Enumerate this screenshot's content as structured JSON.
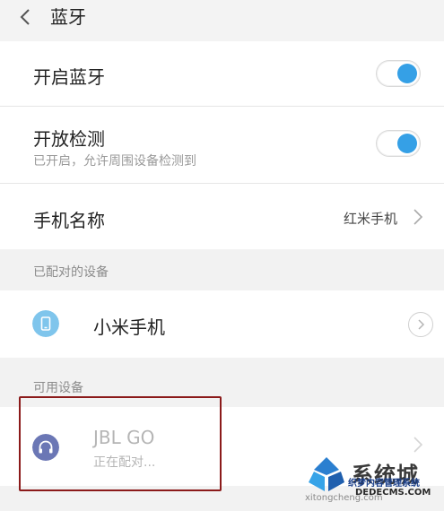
{
  "header": {
    "title": "蓝牙"
  },
  "bluetooth": {
    "label": "开启蓝牙",
    "enabled": true
  },
  "discoverable": {
    "label": "开放检测",
    "subtitle": "已开启，允许周围设备检测到",
    "enabled": true
  },
  "phone_name": {
    "label": "手机名称",
    "value": "红米手机"
  },
  "paired_section": {
    "label": "已配对的设备",
    "devices": [
      {
        "name": "小米手机",
        "icon": "phone-icon"
      }
    ]
  },
  "available_section": {
    "label": "可用设备",
    "devices": [
      {
        "name": "JBL GO",
        "status": "正在配对...",
        "icon": "headphones-icon"
      }
    ]
  },
  "watermark": {
    "main": "系统城",
    "sub": "织梦内容管理系统",
    "url": "DEDECMS.COM",
    "url2": "xitongcheng.com"
  },
  "colors": {
    "accent": "#35a0e6",
    "highlight": "#8b1a1a",
    "headphone_icon": "#6b77b5",
    "phone_icon": "#7fc5ec"
  }
}
